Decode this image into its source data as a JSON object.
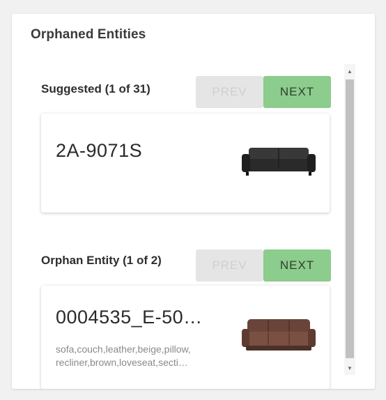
{
  "panel": {
    "title": "Orphaned Entities"
  },
  "suggested": {
    "label": "Suggested (1 of 31)",
    "prev_label": "PREV",
    "next_label": "NEXT",
    "card": {
      "title": "2A-9071S",
      "image_icon": "black-leather-sofa-image"
    }
  },
  "orphan": {
    "label": "Orphan Entity (1 of 2)",
    "prev_label": "PREV",
    "next_label": "NEXT",
    "card": {
      "title": "0004535_E-50…",
      "tags_line1": "sofa,couch,leather,beige,pillow,",
      "tags_line2": "recliner,brown,loveseat,secti…",
      "image_icon": "brown-leather-reclining-sofa-image"
    }
  },
  "colors": {
    "next_button": "#8ccc8c",
    "prev_button": "#e5e5e5"
  }
}
